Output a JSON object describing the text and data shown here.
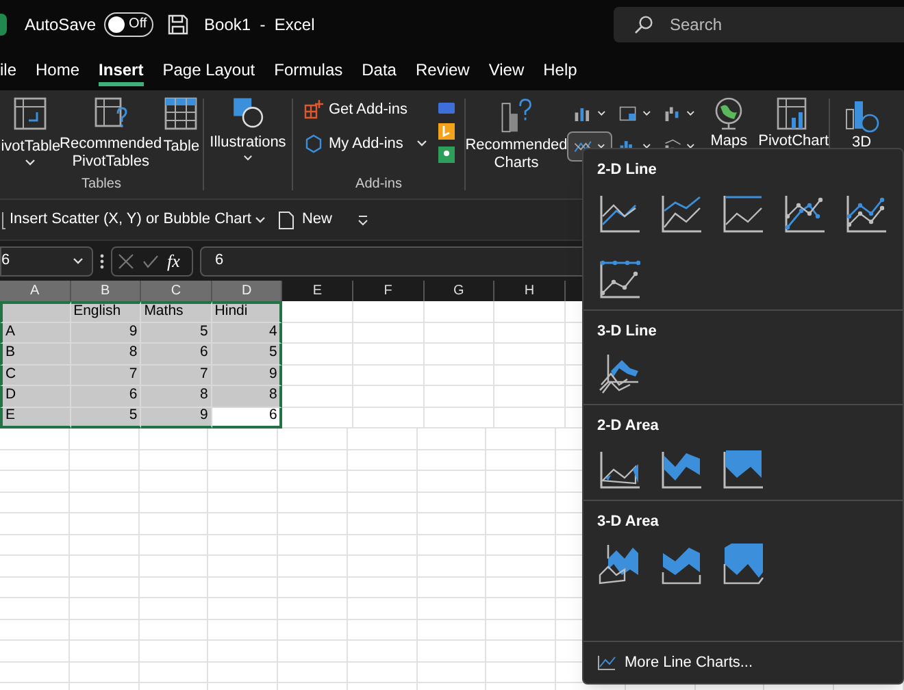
{
  "title_bar": {
    "autosave_label": "AutoSave",
    "autosave": {
      "label": "Off",
      "on": false
    },
    "document_title": "Book1  -  Excel",
    "search": {
      "placeholder": "Search"
    }
  },
  "menu_tabs": [
    {
      "label": "ile",
      "selected": false
    },
    {
      "label": "Home",
      "selected": false
    },
    {
      "label": "Insert",
      "selected": true
    },
    {
      "label": "Page Layout",
      "selected": false
    },
    {
      "label": "Formulas",
      "selected": false
    },
    {
      "label": "Data",
      "selected": false
    },
    {
      "label": "Review",
      "selected": false
    },
    {
      "label": "View",
      "selected": false
    },
    {
      "label": "Help",
      "selected": false
    }
  ],
  "ribbon": {
    "tables_group": {
      "label": "Tables",
      "buttons": [
        "ivotTable",
        "Recommended PivotTables",
        "Table"
      ]
    },
    "illustrations": "Illustrations",
    "addins_group": {
      "label": "Add-ins",
      "buttons": [
        "Get Add-ins",
        "My Add-ins"
      ]
    },
    "charts": {
      "recommended": "Recommended Charts",
      "line_chart_button": {
        "expanded": true
      },
      "maps": "Maps",
      "pivot_chart": "PivotChart"
    },
    "three_d": "3D"
  },
  "quick_toolbar": {
    "items": [
      "Insert Scatter (X, Y) or Bubble Chart",
      "New"
    ]
  },
  "formula_bar": {
    "name_box": "6",
    "function_label": "fx",
    "formula": "6"
  },
  "sheet": {
    "columns": [
      {
        "label": "A",
        "selected": true
      },
      {
        "label": "B",
        "selected": true
      },
      {
        "label": "C",
        "selected": true
      },
      {
        "label": "D",
        "selected": true
      },
      {
        "label": "E",
        "selected": false
      },
      {
        "label": "F",
        "selected": false
      },
      {
        "label": "G",
        "selected": false
      },
      {
        "label": "H",
        "selected": false
      }
    ],
    "rows": [
      {
        "selected": true,
        "cells": [
          {
            "kind": "empty",
            "active": false
          },
          {
            "kind": "text",
            "text": "English",
            "active": false
          },
          {
            "kind": "text",
            "text": "Maths",
            "active": false
          },
          {
            "kind": "text",
            "text": "Hindi",
            "active": false
          }
        ]
      },
      {
        "selected": true,
        "cells": [
          {
            "kind": "text",
            "text": "A",
            "active": false
          },
          {
            "kind": "number",
            "text": "9",
            "active": false
          },
          {
            "kind": "number",
            "text": "5",
            "active": false
          },
          {
            "kind": "number",
            "text": "4",
            "active": false
          }
        ]
      },
      {
        "selected": true,
        "cells": [
          {
            "kind": "text",
            "text": "B",
            "active": false
          },
          {
            "kind": "number",
            "text": "8",
            "active": false
          },
          {
            "kind": "number",
            "text": "6",
            "active": false
          },
          {
            "kind": "number",
            "text": "5",
            "active": false
          }
        ]
      },
      {
        "selected": true,
        "cells": [
          {
            "kind": "text",
            "text": "C",
            "active": false
          },
          {
            "kind": "number",
            "text": "7",
            "active": false
          },
          {
            "kind": "number",
            "text": "7",
            "active": false
          },
          {
            "kind": "number",
            "text": "9",
            "active": false
          }
        ]
      },
      {
        "selected": true,
        "cells": [
          {
            "kind": "text",
            "text": "D",
            "active": false
          },
          {
            "kind": "number",
            "text": "6",
            "active": false
          },
          {
            "kind": "number",
            "text": "8",
            "active": false
          },
          {
            "kind": "number",
            "text": "8",
            "active": false
          }
        ]
      },
      {
        "selected": true,
        "cells": [
          {
            "kind": "text",
            "text": "E",
            "active": false
          },
          {
            "kind": "number",
            "text": "5",
            "active": false
          },
          {
            "kind": "number",
            "text": "9",
            "active": false
          },
          {
            "kind": "number",
            "text": "6",
            "active": true
          }
        ]
      }
    ]
  },
  "line_chart_menu": {
    "sections": [
      {
        "title": "2-D Line",
        "charts": [
          {
            "kind": "line"
          },
          {
            "kind": "stacked-line"
          },
          {
            "kind": "full-line"
          },
          {
            "kind": "line-markers"
          },
          {
            "kind": "stacked-markers"
          },
          {
            "kind": "full-markers"
          }
        ]
      },
      {
        "title": "3-D Line",
        "charts": [
          {
            "kind": "line-3d"
          }
        ]
      },
      {
        "title": "2-D Area",
        "charts": [
          {
            "kind": "area"
          },
          {
            "kind": "stacked-area"
          },
          {
            "kind": "full-area"
          }
        ]
      },
      {
        "title": "3-D Area",
        "charts": [
          {
            "kind": "area-3d"
          },
          {
            "kind": "stacked-area-3d"
          },
          {
            "kind": "full-area-3d"
          }
        ]
      }
    ],
    "footer": "More Line Charts..."
  }
}
